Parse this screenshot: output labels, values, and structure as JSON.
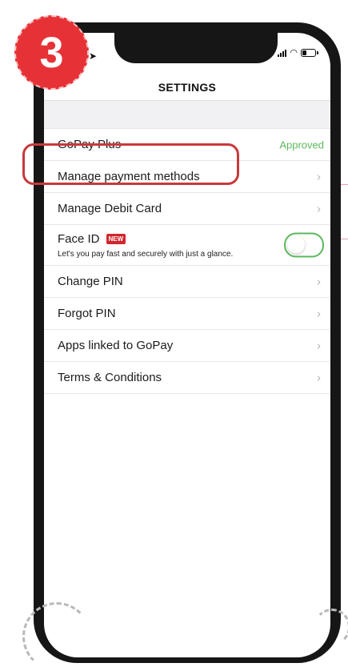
{
  "step_number": "3",
  "status_bar": {
    "left": "➤"
  },
  "header": {
    "title": "SETTINGS"
  },
  "settings": [
    {
      "label": "GoPay Plus",
      "status": "Approved",
      "icon": "none"
    },
    {
      "label": "Manage payment methods",
      "icon": "chevron-right-icon"
    },
    {
      "label": "Manage Debit Card",
      "icon": "chevron-right-icon"
    },
    {
      "label": "Face ID",
      "badge": "NEW",
      "description": "Let's you pay fast and securely with just a glance.",
      "toggle": "off"
    },
    {
      "label": "Change PIN",
      "icon": "chevron-right-icon"
    },
    {
      "label": "Forgot PIN",
      "icon": "chevron-right-icon"
    },
    {
      "label": "Apps linked to GoPay",
      "icon": "chevron-right-icon"
    },
    {
      "label": "Terms & Conditions",
      "icon": "chevron-right-icon"
    }
  ],
  "chevron_glyph": "›",
  "colors": {
    "accent": "#e63237",
    "approved": "#5cb85c",
    "highlight": "#c8383c",
    "toggle_border": "#5cb85c"
  }
}
